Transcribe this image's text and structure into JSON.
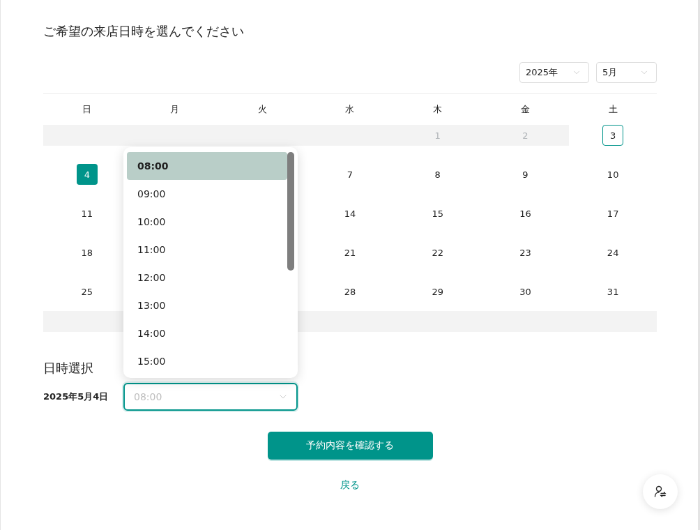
{
  "title": "ご希望の来店日時を選んでください",
  "year_select": {
    "value": "2025年"
  },
  "month_select": {
    "value": "5月"
  },
  "weekdays": [
    "日",
    "月",
    "火",
    "水",
    "木",
    "金",
    "土"
  ],
  "weeks": [
    {
      "sun": {
        "disabled": true
      },
      "mon": {
        "disabled": true
      },
      "tue": {
        "disabled": true
      },
      "wed": {
        "disabled": true
      },
      "thu": {
        "day": "1",
        "disabled": true,
        "selected": false,
        "today": false
      },
      "fri": {
        "day": "2",
        "disabled": true,
        "selected": false,
        "today": false
      },
      "sat": {
        "day": "3",
        "disabled": false,
        "selected": false,
        "today": true
      }
    },
    {
      "sun": {
        "day": "4",
        "disabled": false,
        "selected": true,
        "today": false
      },
      "wed": {
        "day": "7",
        "disabled": false,
        "selected": false,
        "today": false
      },
      "thu": {
        "day": "8",
        "disabled": false,
        "selected": false,
        "today": false
      },
      "fri": {
        "day": "9",
        "disabled": false,
        "selected": false,
        "today": false
      },
      "sat": {
        "day": "10",
        "disabled": false,
        "selected": false,
        "today": false
      }
    },
    {
      "sun": {
        "day": "11",
        "disabled": false,
        "selected": false,
        "today": false
      },
      "wed": {
        "day": "14",
        "disabled": false,
        "selected": false,
        "today": false
      },
      "thu": {
        "day": "15",
        "disabled": false,
        "selected": false,
        "today": false
      },
      "fri": {
        "day": "16",
        "disabled": false,
        "selected": false,
        "today": false
      },
      "sat": {
        "day": "17",
        "disabled": false,
        "selected": false,
        "today": false
      }
    },
    {
      "sun": {
        "day": "18",
        "disabled": false,
        "selected": false,
        "today": false
      },
      "wed": {
        "day": "21",
        "disabled": false,
        "selected": false,
        "today": false
      },
      "thu": {
        "day": "22",
        "disabled": false,
        "selected": false,
        "today": false
      },
      "fri": {
        "day": "23",
        "disabled": false,
        "selected": false,
        "today": false
      },
      "sat": {
        "day": "24",
        "disabled": false,
        "selected": false,
        "today": false
      }
    },
    {
      "sun": {
        "day": "25",
        "disabled": false,
        "selected": false,
        "today": false
      },
      "wed": {
        "day": "28",
        "disabled": false,
        "selected": false,
        "today": false
      },
      "thu": {
        "day": "29",
        "disabled": false,
        "selected": false,
        "today": false
      },
      "fri": {
        "day": "30",
        "disabled": false,
        "selected": false,
        "today": false
      },
      "sat": {
        "day": "31",
        "disabled": false,
        "selected": false,
        "today": false
      }
    },
    {
      "sun": {
        "disabled": true
      },
      "tue": {
        "disabled": true
      },
      "wed": {
        "disabled": true
      },
      "thu": {
        "disabled": true
      },
      "fri": {
        "disabled": true
      },
      "sat": {
        "disabled": true
      }
    }
  ],
  "time_section": {
    "heading": "日時選択",
    "date_label": "2025年5月4日",
    "time_field": {
      "placeholder": "08:00",
      "focused": true
    },
    "options": [
      {
        "label": "08:00",
        "selected": true
      },
      {
        "label": "09:00",
        "selected": false
      },
      {
        "label": "10:00",
        "selected": false
      },
      {
        "label": "11:00",
        "selected": false
      },
      {
        "label": "12:00",
        "selected": false
      },
      {
        "label": "13:00",
        "selected": false
      },
      {
        "label": "14:00",
        "selected": false
      },
      {
        "label": "15:00",
        "selected": false
      }
    ]
  },
  "confirm_button": "予約内容を確認する",
  "back_link": "戻る"
}
